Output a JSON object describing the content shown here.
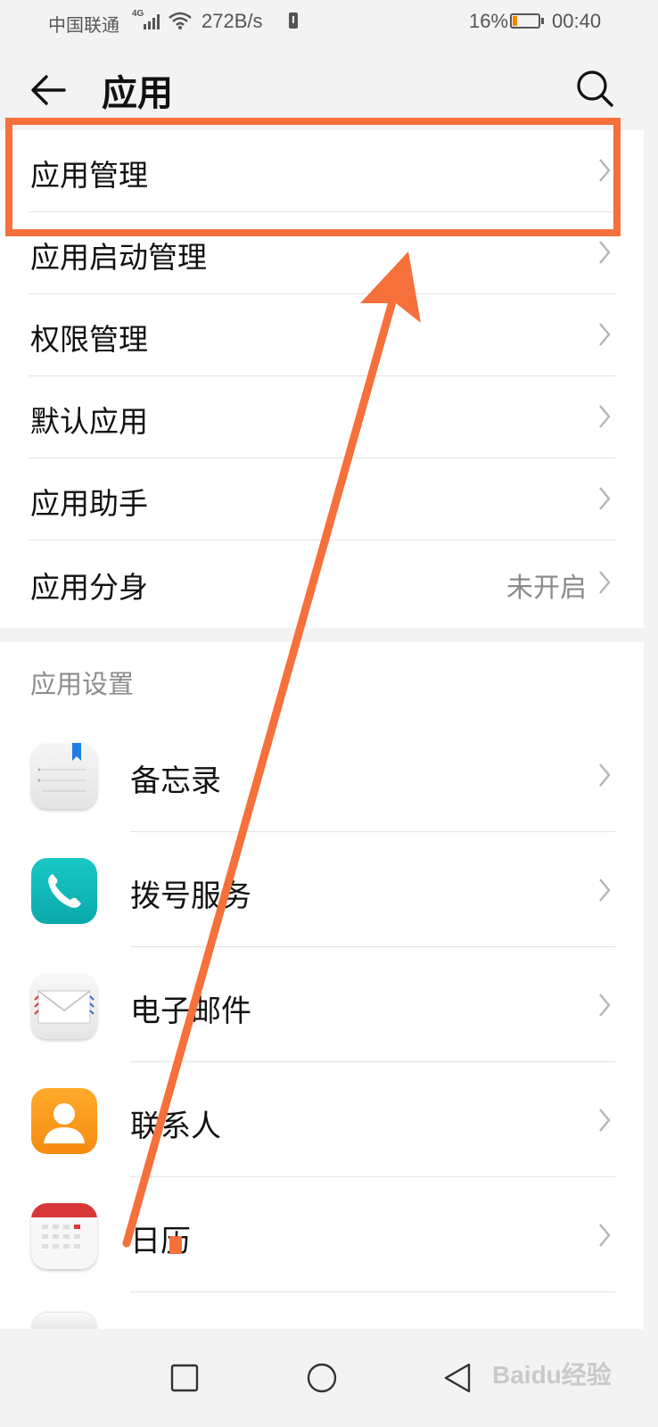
{
  "status_bar": {
    "carrier": "中国联通",
    "network": "4G",
    "speed": "272B/s",
    "battery": "16%",
    "battery_level": 0.16,
    "time": "00:40"
  },
  "header": {
    "title": "应用",
    "back_icon": "back-arrow-icon",
    "search_icon": "search-icon"
  },
  "menu": {
    "items": [
      {
        "label": "应用管理"
      },
      {
        "label": "应用启动管理"
      },
      {
        "label": "权限管理"
      },
      {
        "label": "默认应用"
      },
      {
        "label": "应用助手"
      },
      {
        "label": "应用分身",
        "value": "未开启"
      }
    ]
  },
  "app_settings": {
    "header": "应用设置",
    "apps": [
      {
        "label": "备忘录",
        "icon": "memo-icon"
      },
      {
        "label": "拨号服务",
        "icon": "phone-icon"
      },
      {
        "label": "电子邮件",
        "icon": "mail-icon"
      },
      {
        "label": "联系人",
        "icon": "contacts-icon"
      },
      {
        "label": "日历",
        "icon": "calendar-icon"
      }
    ]
  },
  "annotation": {
    "color": "#f5703b"
  },
  "watermark": "Baidu经验"
}
